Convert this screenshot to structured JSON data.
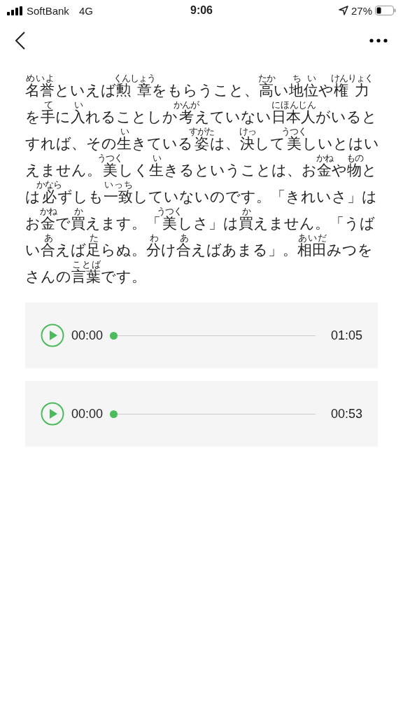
{
  "status_bar": {
    "carrier": "SoftBank",
    "network": "4G",
    "time": "9:06",
    "battery": "27%"
  },
  "paragraph": [
    {
      "text": "名誉",
      "ruby": "めいよ"
    },
    {
      "text": "といえば"
    },
    {
      "text": "勲章",
      "ruby": "くんしょう"
    },
    {
      "text": "をもらうこと、"
    },
    {
      "text": "高",
      "ruby": "たか"
    },
    {
      "text": "い"
    },
    {
      "text": "地位",
      "ruby": "ちい"
    },
    {
      "text": "や"
    },
    {
      "text": "権力",
      "ruby": "けんりょく"
    },
    {
      "text": "を"
    },
    {
      "text": "手",
      "ruby": "て"
    },
    {
      "text": "に"
    },
    {
      "text": "入",
      "ruby": "い"
    },
    {
      "text": "れることしか"
    },
    {
      "text": "考",
      "ruby": "かんが"
    },
    {
      "text": "えていない"
    },
    {
      "text": "日本人",
      "ruby": "にほんじん"
    },
    {
      "text": "がいるとすれば、その"
    },
    {
      "text": "生",
      "ruby": "い"
    },
    {
      "text": "きている"
    },
    {
      "text": "姿",
      "ruby": "すがた"
    },
    {
      "text": "は、"
    },
    {
      "text": "決",
      "ruby": "けっ"
    },
    {
      "text": "して"
    },
    {
      "text": "美",
      "ruby": "うつく"
    },
    {
      "text": "しいとはいえません。"
    },
    {
      "text": "美",
      "ruby": "うつく"
    },
    {
      "text": "しく"
    },
    {
      "text": "生",
      "ruby": "い"
    },
    {
      "text": "きるということは、お"
    },
    {
      "text": "金",
      "ruby": "かね"
    },
    {
      "text": "や"
    },
    {
      "text": "物",
      "ruby": "もの"
    },
    {
      "text": "とは"
    },
    {
      "text": "必",
      "ruby": "かなら"
    },
    {
      "text": "ずしも"
    },
    {
      "text": "一致",
      "ruby": "いっち"
    },
    {
      "text": "していないのです。「きれいさ」はお"
    },
    {
      "text": "金",
      "ruby": "かね"
    },
    {
      "text": "で"
    },
    {
      "text": "買",
      "ruby": "か"
    },
    {
      "text": "えます。「"
    },
    {
      "text": "美",
      "ruby": "うつく"
    },
    {
      "text": "しさ」は"
    },
    {
      "text": "買",
      "ruby": "か"
    },
    {
      "text": "えません。「うばい"
    },
    {
      "text": "合",
      "ruby": "あ"
    },
    {
      "text": "えば"
    },
    {
      "text": "足",
      "ruby": "た"
    },
    {
      "text": "らぬ。"
    },
    {
      "text": "分",
      "ruby": "わ"
    },
    {
      "text": "け"
    },
    {
      "text": "合",
      "ruby": "あ"
    },
    {
      "text": "えばあまる」。"
    },
    {
      "text": "相田",
      "ruby": "あいだ"
    },
    {
      "text": "みつをさんの"
    },
    {
      "text": "言葉",
      "ruby": "ことば"
    },
    {
      "text": "です。"
    }
  ],
  "players": [
    {
      "current": "00:00",
      "duration": "01:05",
      "level": 0
    },
    {
      "current": "00:00",
      "duration": "00:53",
      "level": 0
    }
  ]
}
